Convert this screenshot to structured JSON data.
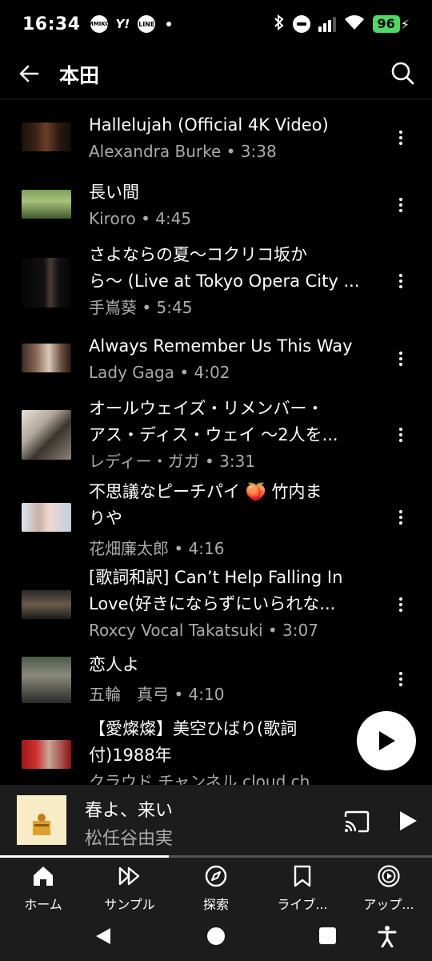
{
  "status": {
    "time": "16:34",
    "notif_icons": [
      "mmiko-badge",
      "yahoo-icon",
      "line-icon"
    ],
    "mmiko": "MMIKO",
    "yahoo": "Y!",
    "line": "LINE",
    "battery": "96"
  },
  "header": {
    "title": "本田"
  },
  "tracks": [
    {
      "title": "Hallelujah (Official 4K Video)",
      "subtitle": "Alexandra Burke • 3:38"
    },
    {
      "title": "長い間",
      "subtitle": "Kiroro • 4:45"
    },
    {
      "title": "さよならの夏〜コクリコ坂か",
      "title2": "ら〜 (Live at Tokyo Opera City ...",
      "subtitle": "手嶌葵 • 5:45"
    },
    {
      "title": "Always Remember Us This Way",
      "subtitle": "Lady Gaga • 4:02"
    },
    {
      "title": "オールウェイズ・リメンバー・",
      "title2": "アス・ディス・ウェイ 〜2人を...",
      "subtitle": "レディー・ガガ • 3:31"
    },
    {
      "title": "不思議なピーチパイ 🍑 竹内ま",
      "title2": "りや",
      "subtitle": "花畑廉太郎 • 4:16"
    },
    {
      "title": "[歌詞和訳] Can’t Help Falling In",
      "title2": "Love(好きにならずにいられな...",
      "subtitle": "Roxcy Vocal Takatsuki • 3:07"
    },
    {
      "title": "恋人よ",
      "subtitle": "五輪　真弓 • 4:10"
    },
    {
      "title": "【愛燦燦】美空ひばり(歌詞",
      "title2": "付)1988年",
      "subtitle": "クラウド チャンネル cloud ch..."
    }
  ],
  "now_playing": {
    "title": "春よ、来い",
    "artist": "松任谷由実",
    "progress": 0.39
  },
  "nav": [
    {
      "label": "ホーム",
      "icon": "home-icon",
      "active": true
    },
    {
      "label": "サンプル",
      "icon": "samples-icon"
    },
    {
      "label": "探索",
      "icon": "explore-icon"
    },
    {
      "label": "ライブ...",
      "icon": "library-icon"
    },
    {
      "label": "アップ...",
      "icon": "upgrade-icon"
    }
  ],
  "colors": {
    "background": "#000000",
    "secondary_text": "#aaaaaa",
    "battery": "#4cd964",
    "player_bg": "#1c1c1c"
  }
}
